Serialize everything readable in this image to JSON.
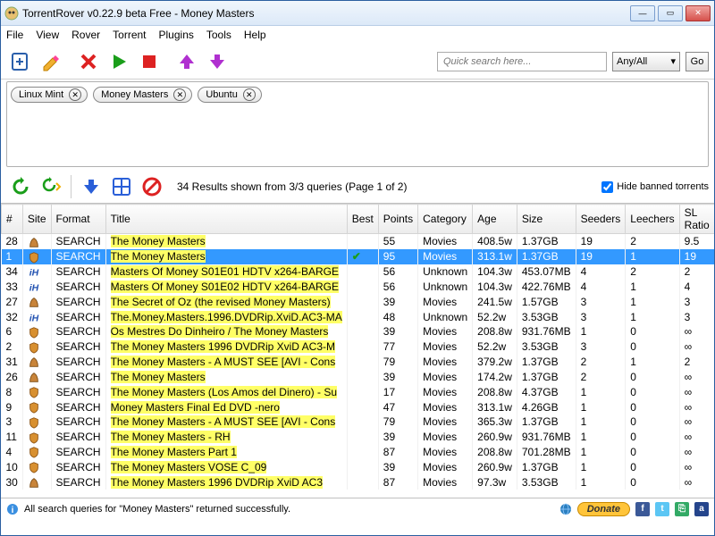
{
  "window": {
    "title": "TorrentRover v0.22.9 beta Free - Money Masters",
    "min": "—",
    "max": "▭",
    "close": "✕"
  },
  "menu": [
    "File",
    "View",
    "Rover",
    "Torrent",
    "Plugins",
    "Tools",
    "Help"
  ],
  "search": {
    "placeholder": "Quick search here...",
    "combo": "Any/All",
    "go": "Go"
  },
  "tags": [
    "Linux Mint",
    "Money Masters",
    "Ubuntu"
  ],
  "mid": {
    "info": "34 Results shown from 3/3 queries (Page 1 of 2)",
    "hide": "Hide banned torrents"
  },
  "columns": [
    "#",
    "Site",
    "Format",
    "Title",
    "Best",
    "Points",
    "Category",
    "Age",
    "Size",
    "Seeders",
    "Leechers",
    "SL Ratio"
  ],
  "rows": [
    {
      "n": "28",
      "site": "pb",
      "fmt": "SEARCH",
      "title": "The Money Masters",
      "best": "",
      "pts": "55",
      "cat": "Movies",
      "age": "408.5w",
      "size": "1.37GB",
      "seed": "19",
      "leech": "2",
      "sl": "9.5",
      "sel": false
    },
    {
      "n": "1",
      "site": "iso",
      "fmt": "SEARCH",
      "title": "The Money Masters",
      "best": "✓",
      "pts": "95",
      "cat": "Movies",
      "age": "313.1w",
      "size": "1.37GB",
      "seed": "19",
      "leech": "1",
      "sl": "19",
      "sel": true
    },
    {
      "n": "34",
      "site": "ih",
      "fmt": "SEARCH",
      "title": "Masters Of Money S01E01 HDTV x264-BARGE",
      "best": "",
      "pts": "56",
      "cat": "Unknown",
      "age": "104.3w",
      "size": "453.07MB",
      "seed": "4",
      "leech": "2",
      "sl": "2",
      "sel": false
    },
    {
      "n": "33",
      "site": "ih",
      "fmt": "SEARCH",
      "title": "Masters Of Money S01E02 HDTV x264-BARGE",
      "best": "",
      "pts": "56",
      "cat": "Unknown",
      "age": "104.3w",
      "size": "422.76MB",
      "seed": "4",
      "leech": "1",
      "sl": "4",
      "sel": false
    },
    {
      "n": "27",
      "site": "pb",
      "fmt": "SEARCH",
      "title": "The Secret of Oz (the revised Money Masters)",
      "best": "",
      "pts": "39",
      "cat": "Movies",
      "age": "241.5w",
      "size": "1.57GB",
      "seed": "3",
      "leech": "1",
      "sl": "3",
      "sel": false
    },
    {
      "n": "32",
      "site": "ih",
      "fmt": "SEARCH",
      "title": "The.Money.Masters.1996.DVDRip.XviD.AC3-MA",
      "best": "",
      "pts": "48",
      "cat": "Unknown",
      "age": "52.2w",
      "size": "3.53GB",
      "seed": "3",
      "leech": "1",
      "sl": "3",
      "sel": false
    },
    {
      "n": "6",
      "site": "iso",
      "fmt": "SEARCH",
      "title": "Os Mestres Do Dinheiro / The Money Masters",
      "best": "",
      "pts": "39",
      "cat": "Movies",
      "age": "208.8w",
      "size": "931.76MB",
      "seed": "1",
      "leech": "0",
      "sl": "∞",
      "sel": false
    },
    {
      "n": "2",
      "site": "iso",
      "fmt": "SEARCH",
      "title": "The Money Masters 1996 DVDRip XviD AC3-M",
      "best": "",
      "pts": "77",
      "cat": "Movies",
      "age": "52.2w",
      "size": "3.53GB",
      "seed": "3",
      "leech": "0",
      "sl": "∞",
      "sel": false
    },
    {
      "n": "31",
      "site": "pb",
      "fmt": "SEARCH",
      "title": "The Money Masters - A MUST SEE [AVI - Cons",
      "best": "",
      "pts": "79",
      "cat": "Movies",
      "age": "379.2w",
      "size": "1.37GB",
      "seed": "2",
      "leech": "1",
      "sl": "2",
      "sel": false
    },
    {
      "n": "26",
      "site": "pb",
      "fmt": "SEARCH",
      "title": "The Money Masters",
      "best": "",
      "pts": "39",
      "cat": "Movies",
      "age": "174.2w",
      "size": "1.37GB",
      "seed": "2",
      "leech": "0",
      "sl": "∞",
      "sel": false
    },
    {
      "n": "8",
      "site": "iso",
      "fmt": "SEARCH",
      "title": "The Money Masters (Los Amos del Dinero) - Su",
      "best": "",
      "pts": "17",
      "cat": "Movies",
      "age": "208.8w",
      "size": "4.37GB",
      "seed": "1",
      "leech": "0",
      "sl": "∞",
      "sel": false
    },
    {
      "n": "9",
      "site": "iso",
      "fmt": "SEARCH",
      "title": "Money Masters Final Ed  DVD -nero",
      "best": "",
      "pts": "47",
      "cat": "Movies",
      "age": "313.1w",
      "size": "4.26GB",
      "seed": "1",
      "leech": "0",
      "sl": "∞",
      "sel": false
    },
    {
      "n": "3",
      "site": "iso",
      "fmt": "SEARCH",
      "title": "The Money Masters - A MUST SEE [AVI - Cons",
      "best": "",
      "pts": "79",
      "cat": "Movies",
      "age": "365.3w",
      "size": "1.37GB",
      "seed": "1",
      "leech": "0",
      "sl": "∞",
      "sel": false
    },
    {
      "n": "11",
      "site": "iso",
      "fmt": "SEARCH",
      "title": "The Money Masters - RH",
      "best": "",
      "pts": "39",
      "cat": "Movies",
      "age": "260.9w",
      "size": "931.76MB",
      "seed": "1",
      "leech": "0",
      "sl": "∞",
      "sel": false
    },
    {
      "n": "4",
      "site": "iso",
      "fmt": "SEARCH",
      "title": "The Money Masters Part 1",
      "best": "",
      "pts": "87",
      "cat": "Movies",
      "age": "208.8w",
      "size": "701.28MB",
      "seed": "1",
      "leech": "0",
      "sl": "∞",
      "sel": false
    },
    {
      "n": "10",
      "site": "iso",
      "fmt": "SEARCH",
      "title": "The Money Masters VOSE C_09",
      "best": "",
      "pts": "39",
      "cat": "Movies",
      "age": "260.9w",
      "size": "1.37GB",
      "seed": "1",
      "leech": "0",
      "sl": "∞",
      "sel": false
    },
    {
      "n": "30",
      "site": "pb",
      "fmt": "SEARCH",
      "title": "The Money Masters 1996 DVDRip XviD AC3",
      "best": "",
      "pts": "87",
      "cat": "Movies",
      "age": "97.3w",
      "size": "3.53GB",
      "seed": "1",
      "leech": "0",
      "sl": "∞",
      "sel": false
    }
  ],
  "status": {
    "msg": "All search queries for \"Money Masters\" returned successfully.",
    "donate": "Donate"
  }
}
